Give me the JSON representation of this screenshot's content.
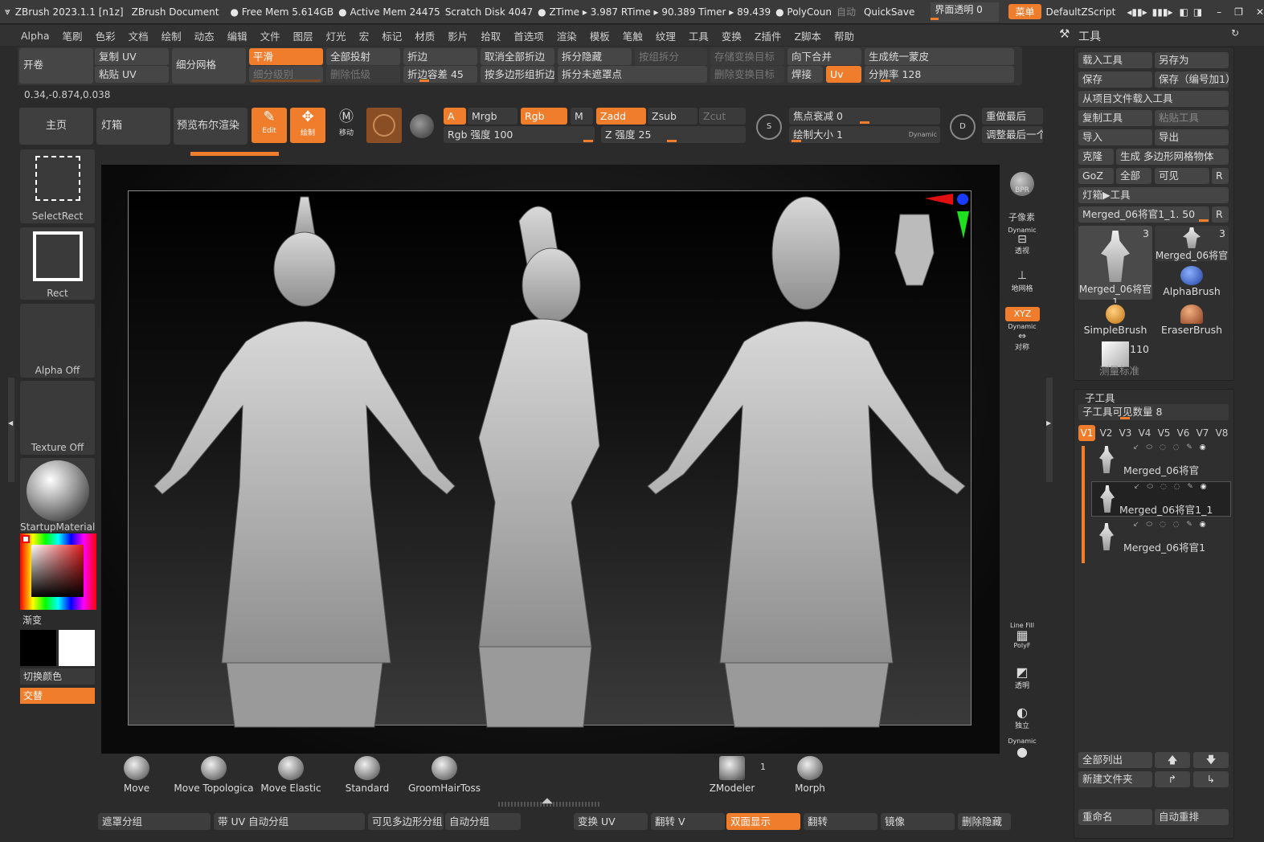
{
  "topbar": {
    "app_title": "ZBrush 2023.1.1 [n1z]",
    "document": "ZBrush Document",
    "free_mem": "Free Mem 5.614GB",
    "active_mem": "Active Mem 24475",
    "scratch": "Scratch Disk 4047",
    "ztime": "ZTime ▸ 3.987 RTime ▸ 90.389 Timer ▸ 89.439",
    "polycount": "PolyCoun",
    "autosave": "自动",
    "quicksave": "QuickSave",
    "ui_transparency": "界面透明 0",
    "menu_btn": "菜单",
    "default_script": "DefaultZScript"
  },
  "menus": [
    "Alpha",
    "笔刷",
    "色彩",
    "文档",
    "绘制",
    "动态",
    "编辑",
    "文件",
    "图层",
    "灯光",
    "宏",
    "标记",
    "材质",
    "影片",
    "拾取",
    "首选项",
    "渲染",
    "模板",
    "笔触",
    "纹理",
    "工具",
    "变换",
    "Z插件",
    "Z脚本",
    "帮助"
  ],
  "top_panel": {
    "row1": [
      "开卷",
      "复制 UV",
      "细分网格",
      "平滑",
      "全部投射",
      "折边",
      "取消全部折边",
      "拆分隐藏",
      "按组拆分",
      "存储变换目标",
      "向下合并",
      "生成统一蒙皮"
    ],
    "row2": [
      "粘贴 UV",
      "细分级别",
      "删除低级",
      "折边容差 45",
      "按多边形组折边",
      "拆分未遮罩点",
      "删除变换目标",
      "焊接",
      "Uv",
      "分辨率 128"
    ],
    "coords": "0.34,-0.874,0.038"
  },
  "shelf": {
    "home": "主页",
    "lightbox": "灯箱",
    "bpr_preview": "预览布尔渲染",
    "edit": "Edit",
    "draw": "绘制",
    "move": "移动",
    "a_btn": "A",
    "mrgb": "Mrgb",
    "rgb": "Rgb",
    "m": "M",
    "zadd": "Zadd",
    "zsub": "Zsub",
    "zcut": "Zcut",
    "rgb_intensity": "Rgb 强度 100",
    "z_intensity": "Z 强度 25",
    "focal_shift": "焦点衰减 0",
    "draw_size": "绘制大小 1",
    "dynamic": "Dynamic",
    "replay_last": "重做最后",
    "adjust_last": "调整最后一个"
  },
  "left": {
    "select_rect": "SelectRect",
    "rect": "Rect",
    "alpha_off": "Alpha Off",
    "texture_off": "Texture Off",
    "material": "StartupMaterial",
    "gradient": "渐变",
    "switch_color": "切换颜色",
    "alternate": "交替"
  },
  "right_shelf": {
    "bpr": "BPR",
    "subpixel": "子像素",
    "persp": "透视",
    "floor": "地网格",
    "xyz": "XYZ",
    "sym": "对称",
    "polyf": "PolyF",
    "line_fill": "Line Fill",
    "transp": "透明",
    "solo": "独立",
    "dynamic": "Dynamic"
  },
  "brushes": [
    "Move",
    "Move Topologica",
    "Move Elastic",
    "Standard",
    "GroomHairToss",
    "ZModeler",
    "Morph"
  ],
  "zmodeler_count": "1",
  "bottom_bar": [
    "遮罩分组",
    "带 UV 自动分组",
    "可见多边形分组",
    "自动分组",
    "变换 UV",
    "翻转 V",
    "双面显示",
    "翻转",
    "镜像",
    "删除隐藏"
  ],
  "tool_panel": {
    "title": "工具",
    "load_tool": "载入工具",
    "save_as": "另存为",
    "save": "保存",
    "save_inc": "保存（编号加1）",
    "load_from_project": "从项目文件载入工具",
    "copy_tool": "复制工具",
    "paste_tool": "粘贴工具",
    "import": "导入",
    "export": "导出",
    "clone": "克隆",
    "make_polymesh": "生成 多边形网格物体",
    "goz": "GoZ",
    "all": "全部",
    "visible": "可见",
    "r": "R",
    "lightbox_tool": "灯箱▶工具",
    "current_tool": "Merged_06将官1_1. 50",
    "thumbs": [
      {
        "label": "Merged_06将官1",
        "count": "3"
      },
      {
        "label": "Merged_06将官1",
        "count": "3"
      },
      {
        "label": "AlphaBrush",
        "count": ""
      },
      {
        "label": "SimpleBrush",
        "count": ""
      },
      {
        "label": "EraserBrush",
        "count": ""
      },
      {
        "label": "测量标准",
        "count": "110"
      }
    ],
    "subtool_title": "子工具",
    "visible_count": "子工具可见数量 8",
    "versions": [
      "V1",
      "V2",
      "V3",
      "V4",
      "V5",
      "V6",
      "V7",
      "V8"
    ],
    "subtools": [
      "Merged_06将官",
      "Merged_06将官1_1",
      "Merged_06将官1"
    ],
    "list_all": "全部列出",
    "new_folder": "新建文件夹",
    "rename": "重命名",
    "auto_reorder": "自动重排"
  },
  "colors": {
    "accent": "#ef7d2c",
    "bg": "#2b2b2b",
    "panel": "#3f3f3f",
    "canvas": "#0e0e0e"
  }
}
